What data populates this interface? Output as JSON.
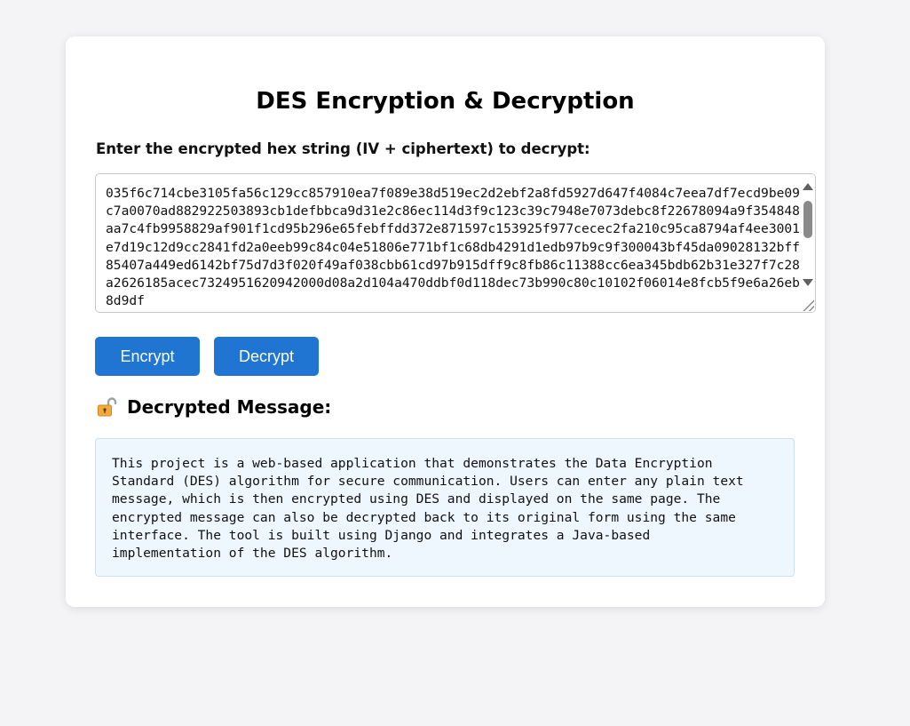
{
  "page": {
    "title": "DES Encryption & Decryption"
  },
  "form": {
    "prompt_label": "Enter the encrypted hex string (IV + ciphertext) to decrypt:",
    "hex_input": "035f6c714cbe3105fa56c129cc857910ea7f089e38d519ec2d2ebf2a8fd5927d647f4084c7eea7df7ecd9be09c7a0070ad882922503893cb1defbbca9d31e2c86ec114d3f9c123c39c7948e7073debc8f22678094a9f354848aa7c4fb9958829af901f1cd95b296e65febffdd372e871597c153925f977cecec2fa210c95ca8794af4ee3001e7d19c12d9cc2841fd2a0eeb99c84c04e51806e771bf1c68db4291d1edb97b9c9f300043bf45da09028132bff85407a449ed6142bf75d7d3f020f49af038cbb61cd97b915dff9c8fb86c11388cc6ea345bdb62b31e327f7c28a2626185acec7324951620942000d08a2d104a470ddbf0d118dec73b990c80c10102f06014e8fcb5f9e6a26eb8d9df",
    "encrypt_label": "Encrypt",
    "decrypt_label": "Decrypt"
  },
  "result": {
    "icon": "unlocked-padlock-icon",
    "heading": "Decrypted Message:",
    "message": "This project is a web-based application that demonstrates the Data Encryption\nStandard (DES) algorithm for secure communication. Users can enter any plain text\nmessage, which is then encrypted using DES and displayed on the same page. The\nencrypted message can also be decrypted back to its original form using the same\ninterface. The tool is built using Django and integrates a Java-based\nimplementation of the DES algorithm."
  },
  "colors": {
    "button": "#1f75d1",
    "result_background": "#eef6fe",
    "page_background": "#f4f4f6"
  }
}
